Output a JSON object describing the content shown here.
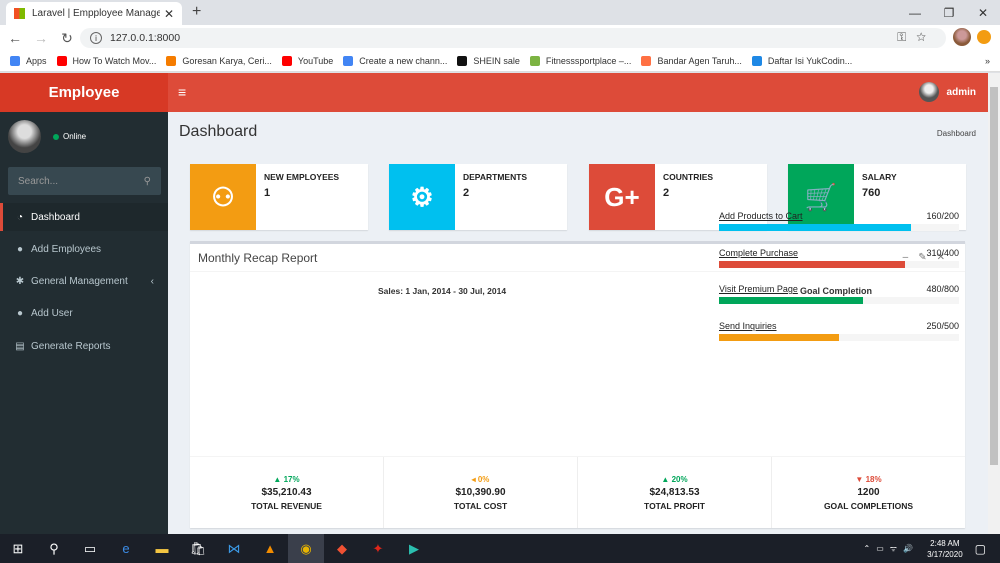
{
  "browser": {
    "tab_title": "Laravel | Empployee Managemen",
    "tab_close": "✕",
    "new_tab": "+",
    "url": "127.0.0.1:8000",
    "window_controls": [
      "—",
      "❐",
      "✕"
    ],
    "bookmarks": [
      {
        "label": "Apps",
        "color": "#4285f4"
      },
      {
        "label": "How To Watch Mov...",
        "color": "#ff0000"
      },
      {
        "label": "Goresan Karya, Ceri...",
        "color": "#f57c00"
      },
      {
        "label": "YouTube",
        "color": "#ff0000"
      },
      {
        "label": "Create a new chann...",
        "color": "#4285f4"
      },
      {
        "label": "SHEIN sale",
        "color": "#111111"
      },
      {
        "label": "Fitnesssportplace –...",
        "color": "#7cb342"
      },
      {
        "label": "Bandar Agen Taruh...",
        "color": "#ff7043"
      },
      {
        "label": "Daftar Isi YukCodin...",
        "color": "#1e88e5"
      }
    ],
    "bookmarks_more": "»"
  },
  "app": {
    "logo": "Employee",
    "hamburger": "≡",
    "admin_label": "admin",
    "user_status": "Online",
    "search_placeholder": "Search...",
    "search_icon": "⚲",
    "menu": [
      {
        "label": "Dashboard",
        "icon": "dashboard-icon",
        "glyph": "◔",
        "active": true
      },
      {
        "label": "Add Employees",
        "icon": "user-icon",
        "glyph": "●"
      },
      {
        "label": "General Management",
        "icon": "gear-icon",
        "glyph": "✱",
        "chevron": "‹"
      },
      {
        "label": "Add User",
        "icon": "user-icon",
        "glyph": "●"
      },
      {
        "label": "Generate Reports",
        "icon": "book-icon",
        "glyph": "▤"
      }
    ]
  },
  "page": {
    "title": "Dashboard",
    "breadcrumb": "Dashboard"
  },
  "info_boxes": [
    {
      "label": "NEW EMPLOYEES",
      "value": "1",
      "color": "#f39c12",
      "icon": "users-icon",
      "glyph": "⚇"
    },
    {
      "label": "DEPARTMENTS",
      "value": "2",
      "color": "#00c0ef",
      "icon": "gear-icon",
      "glyph": "⚙"
    },
    {
      "label": "COUNTRIES",
      "value": "2",
      "color": "#dd4b39",
      "icon": "google-plus-icon",
      "glyph": "G+"
    },
    {
      "label": "SALARY",
      "value": "760",
      "color": "#00a65a",
      "icon": "cart-icon",
      "glyph": "🛒"
    }
  ],
  "report": {
    "title": "Monthly Recap Report",
    "tools": [
      "–",
      "✎",
      "✕"
    ],
    "sales_title": "Sales: 1 Jan, 2014 - 30 Jul, 2014",
    "goal_title": "Goal Completion",
    "goals": [
      {
        "label": "Add Products to Cart",
        "value": "160/200",
        "fraction": 0.8,
        "color": "#00c0ef"
      },
      {
        "label": "Complete Purchase",
        "value": "310/400",
        "fraction": 0.775,
        "color": "#dd4b39"
      },
      {
        "label": "Visit Premium Page",
        "value": "480/800",
        "fraction": 0.6,
        "color": "#00a65a"
      },
      {
        "label": "Send Inquiries",
        "value": "250/500",
        "fraction": 0.5,
        "color": "#f39c12"
      }
    ],
    "stats": [
      {
        "pct": "▲ 17%",
        "amount": "$35,210.43",
        "label": "TOTAL REVENUE",
        "color": "#00a65a"
      },
      {
        "pct": "◂ 0%",
        "amount": "$10,390.90",
        "label": "TOTAL COST",
        "color": "#f39c12"
      },
      {
        "pct": "▲ 20%",
        "amount": "$24,813.53",
        "label": "TOTAL PROFIT",
        "color": "#00a65a"
      },
      {
        "pct": "▼ 18%",
        "amount": "1200",
        "label": "GOAL COMPLETIONS",
        "color": "#dd4b39"
      }
    ]
  },
  "taskbar": {
    "time": "2:48 AM",
    "date": "3/17/2020"
  }
}
